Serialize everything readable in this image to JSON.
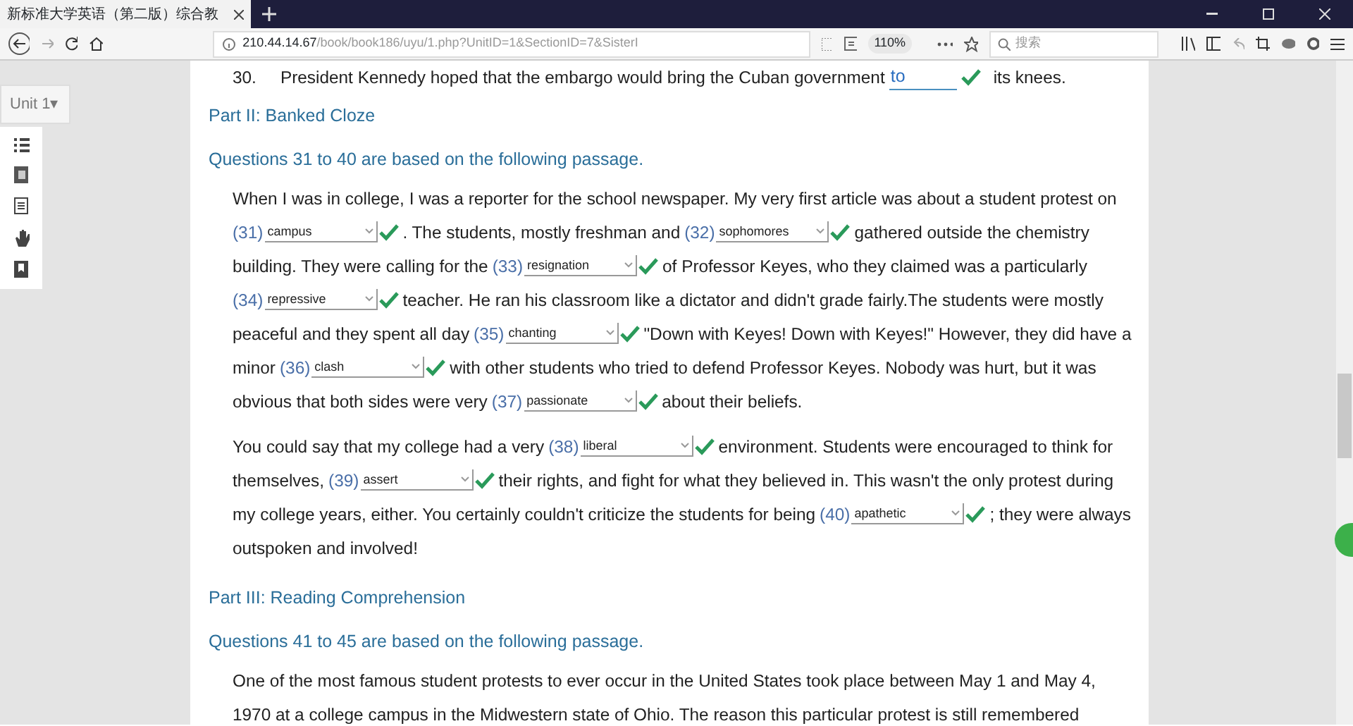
{
  "browser": {
    "tab_title": "新标准大学英语（第二版）综合教",
    "url_host": "210.44.14.67",
    "url_path": "/book/book186/uyu/1.php?UnitID=1&SectionID=7&SisterI",
    "zoom": "110%",
    "search_placeholder": "搜索"
  },
  "sidebar": {
    "unit": "Unit 1▾"
  },
  "question_30": {
    "number": "30.",
    "before": "President Kennedy hoped that the embargo would bring the Cuban government",
    "answer": "to",
    "correct": true,
    "after": "its knees."
  },
  "sections": [
    {
      "part": "Part II: Banked Cloze",
      "instruction": "Questions 31 to 40 are based on the following passage.",
      "paragraphs": [
        [
          [
            {
              "kind": "text",
              "text": "When I was in college, I was a reporter for the school newspaper. My very first article was about a student protest on"
            }
          ],
          [
            {
              "kind": "blank",
              "number": "(31)",
              "answer": "campus",
              "correct": true
            },
            {
              "kind": "text",
              "text": ". The students, mostly freshman and"
            },
            {
              "kind": "blank",
              "number": "(32)",
              "answer": "sophomores",
              "correct": true
            },
            {
              "kind": "text",
              "text": "gathered outside the chemistry"
            }
          ],
          [
            {
              "kind": "text",
              "text": "building. They were calling for the"
            },
            {
              "kind": "blank",
              "number": "(33)",
              "answer": "resignation",
              "correct": true
            },
            {
              "kind": "text",
              "text": "of Professor Keyes, who they claimed was a particularly"
            }
          ],
          [
            {
              "kind": "blank",
              "number": "(34)",
              "answer": "repressive",
              "correct": true
            },
            {
              "kind": "text",
              "text": "teacher. He ran his classroom like a dictator and didn't grade fairly.The students were mostly"
            }
          ],
          [
            {
              "kind": "text",
              "text": "peaceful and they spent all day"
            },
            {
              "kind": "blank",
              "number": "(35)",
              "answer": "chanting",
              "correct": true
            },
            {
              "kind": "text",
              "text": "\"Down with Keyes! Down with Keyes!\" However, they did have a"
            }
          ],
          [
            {
              "kind": "text",
              "text": "minor"
            },
            {
              "kind": "blank",
              "number": "(36)",
              "answer": "clash",
              "correct": true
            },
            {
              "kind": "text",
              "text": "with other students who tried to defend Professor Keyes. Nobody was hurt, but it was"
            }
          ],
          [
            {
              "kind": "text",
              "text": "obvious that both sides were very"
            },
            {
              "kind": "blank",
              "number": "(37)",
              "answer": "passionate",
              "correct": true
            },
            {
              "kind": "text",
              "text": "about their beliefs."
            }
          ]
        ],
        [
          [
            {
              "kind": "text",
              "text": "You could say that my college had a very"
            },
            {
              "kind": "blank",
              "number": "(38)",
              "answer": "liberal",
              "correct": true
            },
            {
              "kind": "text",
              "text": "environment. Students were encouraged to think for"
            }
          ],
          [
            {
              "kind": "text",
              "text": "themselves,"
            },
            {
              "kind": "blank",
              "number": "(39)",
              "answer": "assert",
              "correct": true
            },
            {
              "kind": "text",
              "text": "their rights, and fight for what they believed in. This wasn't the only protest during"
            }
          ],
          [
            {
              "kind": "text",
              "text": "my college years, either. You certainly couldn't criticize the students for being"
            },
            {
              "kind": "blank",
              "number": "(40)",
              "answer": "apathetic",
              "correct": true
            },
            {
              "kind": "text",
              "text": "; they were always"
            }
          ],
          [
            {
              "kind": "text",
              "text": "outspoken and involved!"
            }
          ]
        ]
      ]
    },
    {
      "part": "Part III: Reading Comprehension",
      "instruction": "Questions 41 to 45 are based on the following passage.",
      "paragraphs": [
        [
          [
            {
              "kind": "text",
              "text": "One of the most famous student protests to ever occur in the United States took place between May 1 and May 4,"
            }
          ],
          [
            {
              "kind": "text",
              "text": "1970 at a college campus in the Midwestern state of Ohio. The reason this particular protest is still remembered"
            }
          ]
        ]
      ]
    }
  ]
}
